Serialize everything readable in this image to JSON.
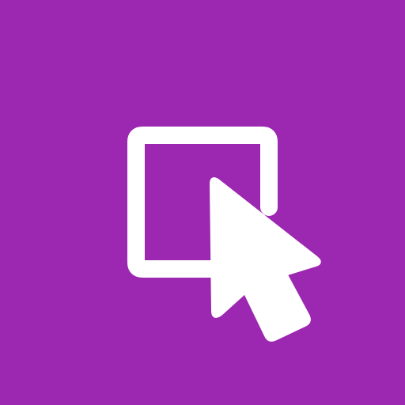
{
  "app": {
    "icon": "select-object-icon",
    "colors": {
      "background": "#9c27b0",
      "foreground": "#ffffff"
    }
  }
}
